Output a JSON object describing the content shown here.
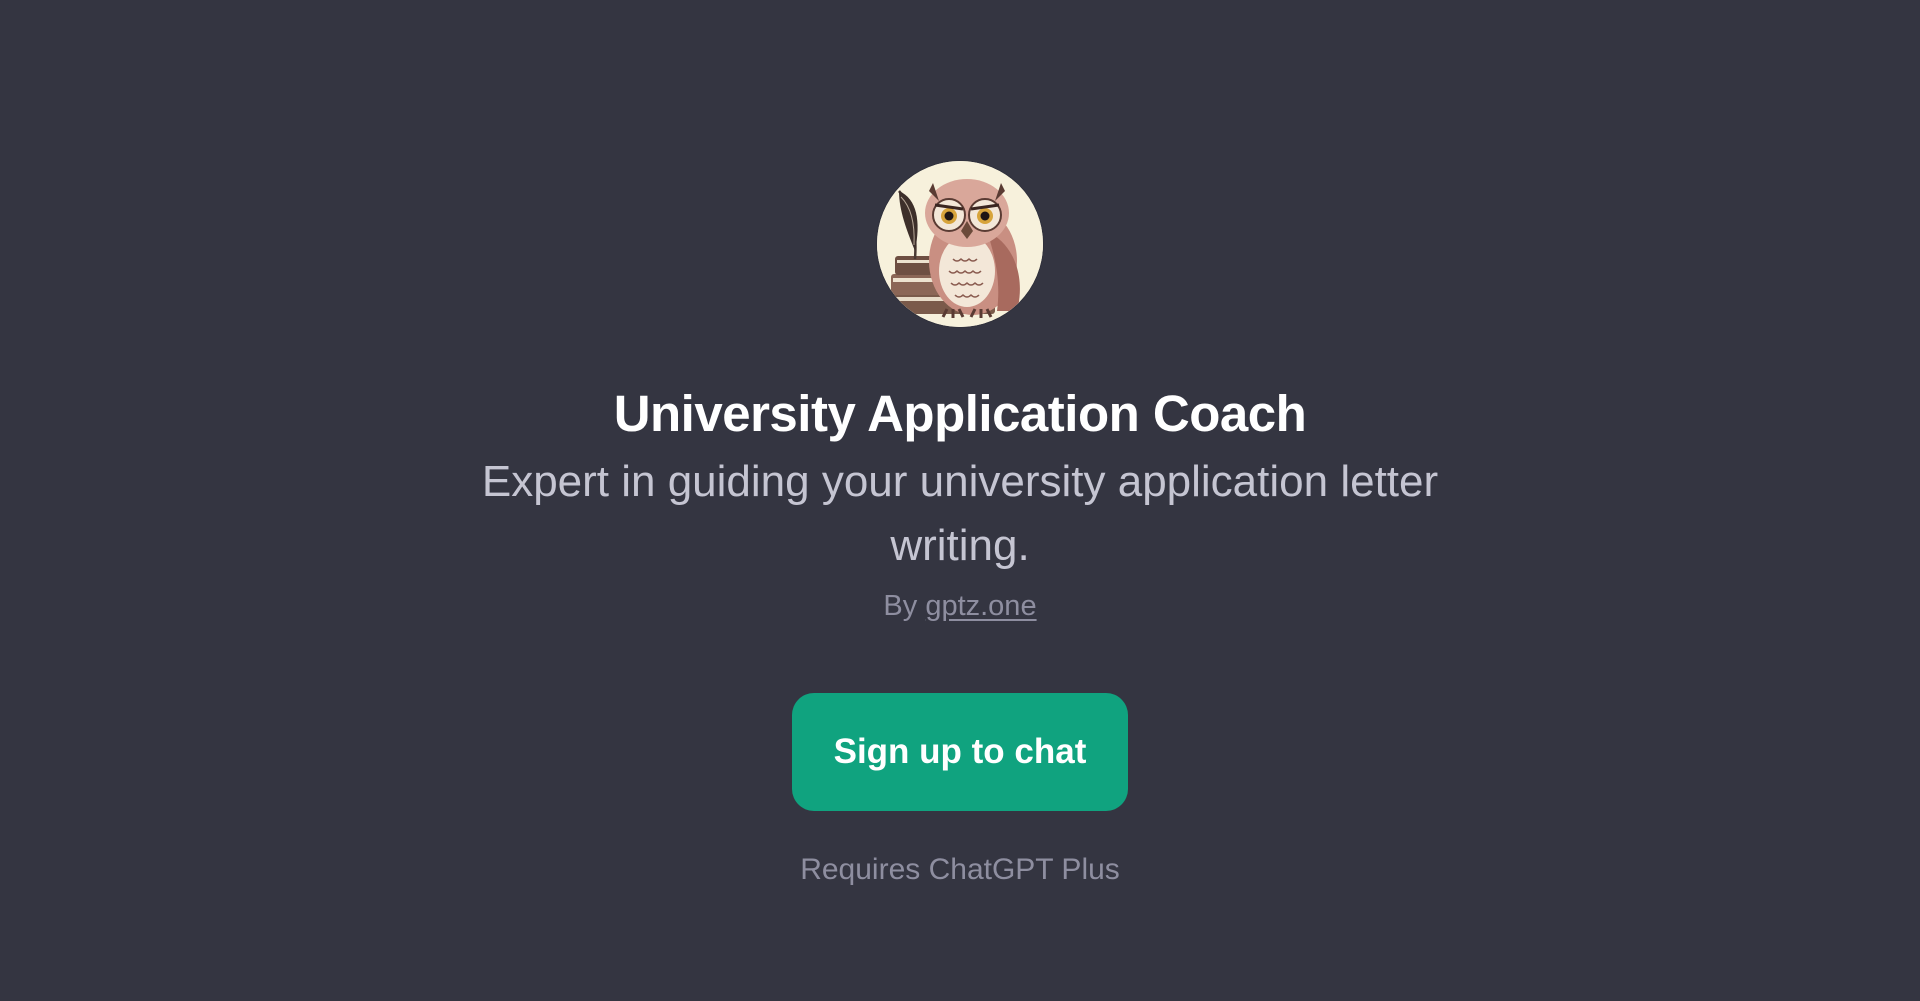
{
  "gpt": {
    "avatar_icon": "owl-icon",
    "title": "University Application Coach",
    "description": "Expert in guiding your university application letter writing.",
    "byline_prefix": "By",
    "author": "gptz.one"
  },
  "actions": {
    "signup_label": "Sign up to chat",
    "requirement_note": "Requires ChatGPT Plus"
  },
  "colors": {
    "background": "#343541",
    "title": "#ffffff",
    "description": "#c5c5d2",
    "muted": "#8e8ea0",
    "accent": "#10a37f"
  }
}
